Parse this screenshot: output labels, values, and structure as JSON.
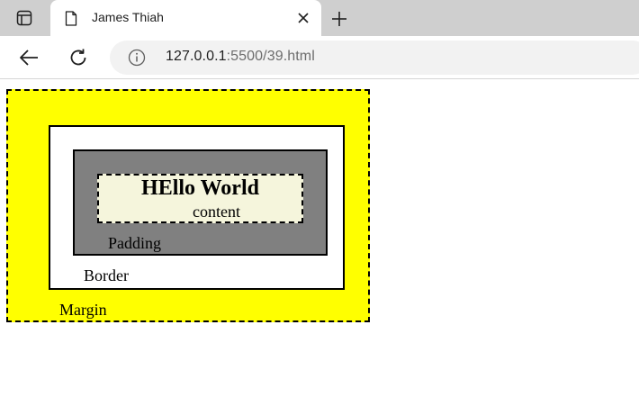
{
  "browser": {
    "tab": {
      "title": "James Thiah",
      "favicon": "page-icon"
    },
    "icons": {
      "tab_actions": "tab-actions-icon",
      "close": "close-icon",
      "new_tab": "plus-icon",
      "back": "back-arrow-icon",
      "reload": "reload-icon",
      "site_info": "info-icon"
    },
    "url": {
      "host": "127.0.0.1",
      "path": ":5500/39.html"
    }
  },
  "page": {
    "heading": "HEllo World",
    "content_label": "content",
    "padding_label": "Padding",
    "border_label": "Border",
    "margin_label": "Margin",
    "colors": {
      "margin": "#ffff00",
      "border": "#ffffff",
      "padding": "#808080",
      "content": "#f5f5dc"
    }
  }
}
